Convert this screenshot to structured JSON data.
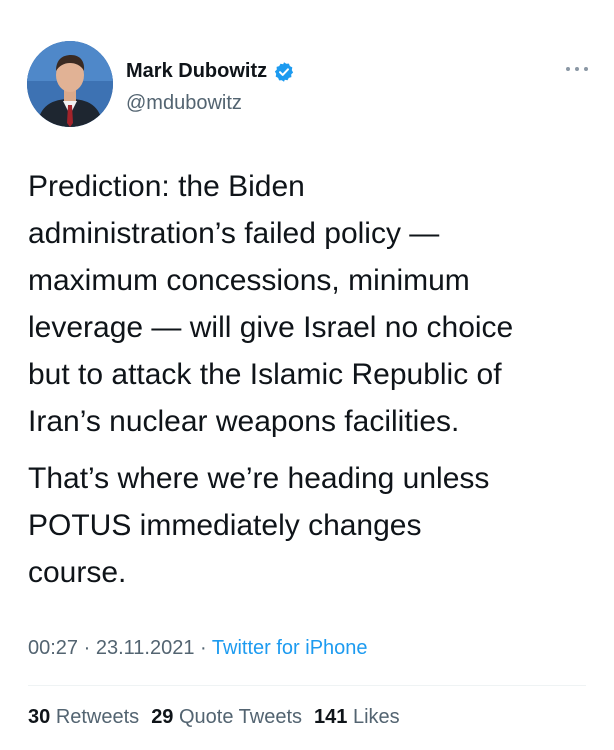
{
  "author": {
    "name": "Mark Dubowitz",
    "handle": "@mdubowitz",
    "verified": true
  },
  "tweet": {
    "paragraphs": [
      "Prediction: the Biden\nadministration’s failed policy —\nmaximum concessions, minimum\nleverage — will give Israel no choice\nbut to attack the Islamic Republic of\nIran’s nuclear weapons facilities.",
      "That’s where we’re heading unless\nPOTUS immediately changes\ncourse."
    ],
    "time": "00:27",
    "date": "23.11.2021",
    "separator": "·",
    "source": "Twitter for iPhone"
  },
  "stats": {
    "retweets": {
      "count": "30",
      "label": "Retweets"
    },
    "quote_tweets": {
      "count": "29",
      "label": "Quote Tweets"
    },
    "likes": {
      "count": "141",
      "label": "Likes"
    }
  },
  "icons": {
    "more": "more-options-icon",
    "verified": "verified-badge-icon"
  },
  "colors": {
    "accent": "#1d9bf0",
    "secondary_text": "#536471",
    "primary_text": "#0f1419"
  }
}
